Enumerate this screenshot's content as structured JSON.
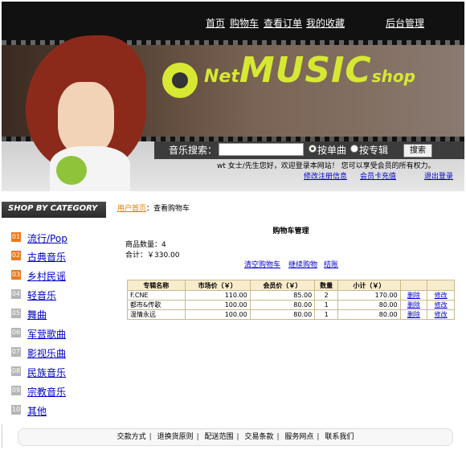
{
  "header": {
    "nav": [
      "首页",
      "购物车",
      "查看订单",
      "我的收藏"
    ],
    "admin_link": "后台管理",
    "logo": {
      "net": "Net",
      "music": "MUSIC",
      "shop": "shop"
    },
    "search": {
      "label": "音乐搜索：",
      "input_value": "",
      "options": [
        "按单曲",
        "按专辑"
      ],
      "selected_option": "按单曲",
      "button": "搜索"
    },
    "welcome": "wt 女士/先生您好，欢迎登录本网站！ 您可以享受会员的所有权力。",
    "account_links": [
      "修改注册信息",
      "会员卡充值",
      "退出登录"
    ]
  },
  "sidebar": {
    "title": "SHOP BY CATEGORY",
    "items": [
      {
        "num": "01",
        "label": "流行/Pop"
      },
      {
        "num": "02",
        "label": "古典音乐"
      },
      {
        "num": "03",
        "label": "乡村民谣"
      },
      {
        "num": "04",
        "label": "轻音乐"
      },
      {
        "num": "05",
        "label": "舞曲"
      },
      {
        "num": "06",
        "label": "军营歌曲"
      },
      {
        "num": "07",
        "label": "影视乐曲"
      },
      {
        "num": "08",
        "label": "民族音乐"
      },
      {
        "num": "09",
        "label": "宗教音乐"
      },
      {
        "num": "10",
        "label": "其他"
      }
    ]
  },
  "breadcrumb": {
    "home": "用户首页",
    "current": "查看购物车"
  },
  "cart": {
    "title": "购物车管理",
    "count_label": "商品数量：",
    "count": "4",
    "total_label": "合计：",
    "total": "￥330.00",
    "actions": [
      "清空购物车",
      "继续购物",
      "结账"
    ],
    "columns": [
      "专辑名称",
      "市场价（￥）",
      "会员价（￥）",
      "数量",
      "小计（￥）",
      "",
      ""
    ],
    "rows": [
      {
        "name": "F.CNE",
        "market": "110.00",
        "member": "85.00",
        "qty": "2",
        "subtotal": "170.00",
        "del": "删除",
        "edit": "修改"
      },
      {
        "name": "都市&传歌",
        "market": "100.00",
        "member": "80.00",
        "qty": "1",
        "subtotal": "80.00",
        "del": "删除",
        "edit": "修改"
      },
      {
        "name": "温情永远",
        "market": "100.00",
        "member": "80.00",
        "qty": "1",
        "subtotal": "80.00",
        "del": "删除",
        "edit": "修改"
      }
    ]
  },
  "footer": {
    "links": [
      "交款方式",
      "退换货原则",
      "配送范围",
      "交易条款",
      "服务网点",
      "联系我们"
    ]
  },
  "colors": {
    "accent_orange": "#ec7a1c",
    "logo_green": "#d7e832",
    "table_header": "#f7eccc"
  }
}
